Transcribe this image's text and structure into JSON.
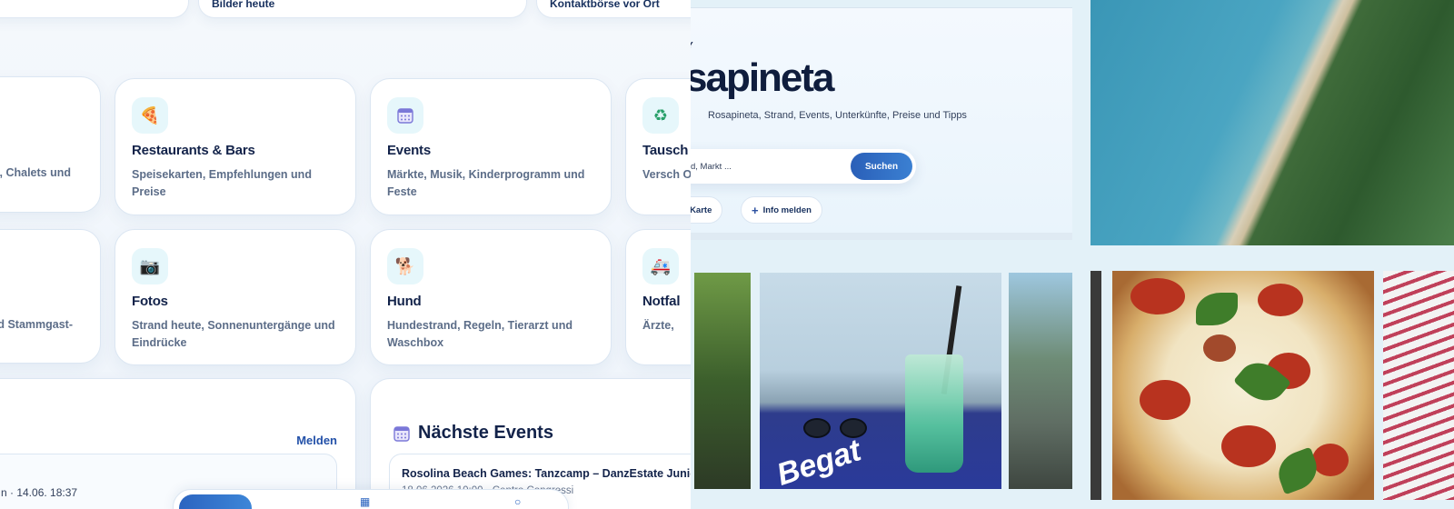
{
  "top_pills": [
    "Bilder heute",
    "Kontaktbörse vor Ort"
  ],
  "category_cards": [
    {
      "id": "unterkuenfte",
      "title": "",
      "desc": "s, Chalets und",
      "icon": "house-icon"
    },
    {
      "id": "restaurants",
      "title": "Restaurants & Bars",
      "desc": "Speisekarten, Empfehlungen und Preise",
      "icon": "pizza-icon"
    },
    {
      "id": "events",
      "title": "Events",
      "desc": "Märkte, Musik, Kinderprogramm und Feste",
      "icon": "calendar-icon"
    },
    {
      "id": "tausch",
      "title": "Tausch",
      "desc": "Versch Ort",
      "icon": "recycle-icon"
    },
    {
      "id": "bewertungen",
      "title": "",
      "desc": "d Stammgast-",
      "icon": "star-icon"
    },
    {
      "id": "fotos",
      "title": "Fotos",
      "desc": "Strand heute, Sonnenuntergänge und Eindrücke",
      "icon": "camera-icon"
    },
    {
      "id": "hund",
      "title": "Hund",
      "desc": "Hundestrand, Regeln, Tierarzt und Waschbox",
      "icon": "dog-icon"
    },
    {
      "id": "notfall",
      "title": "Notfal",
      "desc": "Ärzte,",
      "icon": "ambulance-icon"
    }
  ],
  "reports": {
    "action": "Melden",
    "item_meta": "n · 14.06. 18:37"
  },
  "next_events": {
    "title": "Nächste Events",
    "item": {
      "name": "Rosolina Beach Games: Tanzcamp – DanzEstate Junio",
      "meta": "18.06.2026 10:00 · Centro Congressi"
    }
  },
  "hero": {
    "kicker": "Y",
    "title": "sapineta",
    "subtitle": "Rosapineta, Strand, Events, Unterkünfte, Preise und Tipps",
    "search_placeholder": "d, Markt ...",
    "search_button": "Suchen",
    "chips": [
      {
        "label": "Karte",
        "icon": "map-icon"
      },
      {
        "label": "Info melden",
        "icon": "plus-icon"
      }
    ]
  },
  "photos": {
    "towel_text": "Begat"
  },
  "colors": {
    "accent": "#2b64c0",
    "title": "#13234a",
    "muted": "#5c6d88",
    "link": "#2250a8"
  }
}
